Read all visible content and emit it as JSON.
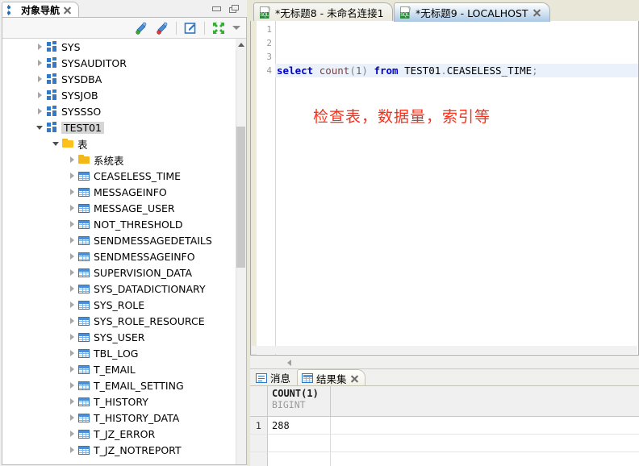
{
  "left_panel": {
    "tab": {
      "title": "对象导航",
      "icon": "navigator-icon",
      "close_icon": "close-icon"
    },
    "window_controls": {
      "minimize": "minimize-icon",
      "maximize": "maximize-icon"
    },
    "toolbar": {
      "buttons": [
        {
          "name": "connect-icon",
          "title": "连接"
        },
        {
          "name": "disconnect-icon",
          "title": "断开连接"
        },
        {
          "name": "edit-icon",
          "title": "编辑"
        },
        {
          "name": "collapse-all-icon",
          "title": "全部折叠"
        },
        {
          "name": "menu-chevron-down-icon",
          "title": "菜单"
        }
      ]
    },
    "tree": [
      {
        "label": "SYS",
        "icon": "schema-icon",
        "indent": 0,
        "state": "collapsed"
      },
      {
        "label": "SYSAUDITOR",
        "icon": "schema-icon",
        "indent": 0,
        "state": "collapsed"
      },
      {
        "label": "SYSDBA",
        "icon": "schema-icon",
        "indent": 0,
        "state": "collapsed"
      },
      {
        "label": "SYSJOB",
        "icon": "schema-icon",
        "indent": 0,
        "state": "collapsed"
      },
      {
        "label": "SYSSSO",
        "icon": "schema-icon",
        "indent": 0,
        "state": "collapsed"
      },
      {
        "label": "TEST01",
        "icon": "schema-icon",
        "indent": 0,
        "state": "expanded",
        "selected": true
      },
      {
        "label": "表",
        "icon": "folder-open-icon",
        "indent": 1,
        "state": "expanded"
      },
      {
        "label": "系统表",
        "icon": "folder-icon",
        "indent": 2,
        "state": "collapsed"
      },
      {
        "label": "CEASELESS_TIME",
        "icon": "table-icon",
        "indent": 2,
        "state": "collapsed"
      },
      {
        "label": "MESSAGEINFO",
        "icon": "table-icon",
        "indent": 2,
        "state": "collapsed"
      },
      {
        "label": "MESSAGE_USER",
        "icon": "table-icon",
        "indent": 2,
        "state": "collapsed"
      },
      {
        "label": "NOT_THRESHOLD",
        "icon": "table-icon",
        "indent": 2,
        "state": "collapsed"
      },
      {
        "label": "SENDMESSAGEDETAILS",
        "icon": "table-icon",
        "indent": 2,
        "state": "collapsed"
      },
      {
        "label": "SENDMESSAGEINFO",
        "icon": "table-icon",
        "indent": 2,
        "state": "collapsed"
      },
      {
        "label": "SUPERVISION_DATA",
        "icon": "table-icon",
        "indent": 2,
        "state": "collapsed"
      },
      {
        "label": "SYS_DATADICTIONARY",
        "icon": "table-icon",
        "indent": 2,
        "state": "collapsed"
      },
      {
        "label": "SYS_ROLE",
        "icon": "table-icon",
        "indent": 2,
        "state": "collapsed"
      },
      {
        "label": "SYS_ROLE_RESOURCE",
        "icon": "table-icon",
        "indent": 2,
        "state": "collapsed"
      },
      {
        "label": "SYS_USER",
        "icon": "table-icon",
        "indent": 2,
        "state": "collapsed"
      },
      {
        "label": "TBL_LOG",
        "icon": "table-icon",
        "indent": 2,
        "state": "collapsed"
      },
      {
        "label": "T_EMAIL",
        "icon": "table-icon",
        "indent": 2,
        "state": "collapsed"
      },
      {
        "label": "T_EMAIL_SETTING",
        "icon": "table-icon",
        "indent": 2,
        "state": "collapsed"
      },
      {
        "label": "T_HISTORY",
        "icon": "table-icon",
        "indent": 2,
        "state": "collapsed"
      },
      {
        "label": "T_HISTORY_DATA",
        "icon": "table-icon",
        "indent": 2,
        "state": "collapsed"
      },
      {
        "label": "T_JZ_ERROR",
        "icon": "table-icon",
        "indent": 2,
        "state": "collapsed"
      },
      {
        "label": "T_JZ_NOTREPORT",
        "icon": "table-icon",
        "indent": 2,
        "state": "collapsed"
      }
    ]
  },
  "editor": {
    "tabs": [
      {
        "label": "*无标题8 - 未命名连接1",
        "icon": "sql-file-icon",
        "active": false,
        "closable": false
      },
      {
        "label": "*无标题9 - LOCALHOST",
        "icon": "sql-file-icon",
        "active": true,
        "closable": true
      }
    ],
    "line_numbers": [
      "1",
      "2",
      "3",
      "4"
    ],
    "sql": {
      "keyword_select": "select",
      "func_count": "count",
      "paren_open": "(",
      "arg": "1",
      "paren_close": ")",
      "keyword_from": "from",
      "schema": "TEST01",
      "dot": ".",
      "table": "CEASELESS_TIME",
      "semicolon": ";"
    },
    "annotation": "检查表，数据量，索引等",
    "collapse_icon": "chevron-left-icon"
  },
  "results": {
    "tabs": [
      {
        "label": "消息",
        "icon": "message-icon",
        "active": false,
        "closable": false
      },
      {
        "label": "结果集",
        "icon": "grid-icon",
        "active": true,
        "closable": true
      }
    ],
    "grid": {
      "column_name": "COUNT(1)",
      "column_type": "BIGINT",
      "rows": [
        {
          "num": "1",
          "value": "288"
        }
      ],
      "empty_rows": 2
    }
  },
  "colors": {
    "accent_blue": "#2e77c4",
    "annotation_red": "#ff2d16",
    "keyword_blue": "#0000d0",
    "tab_chrome": "#e9e8d8",
    "schema_icon": "#3379c6",
    "folder_yellow": "#f4b71a"
  }
}
